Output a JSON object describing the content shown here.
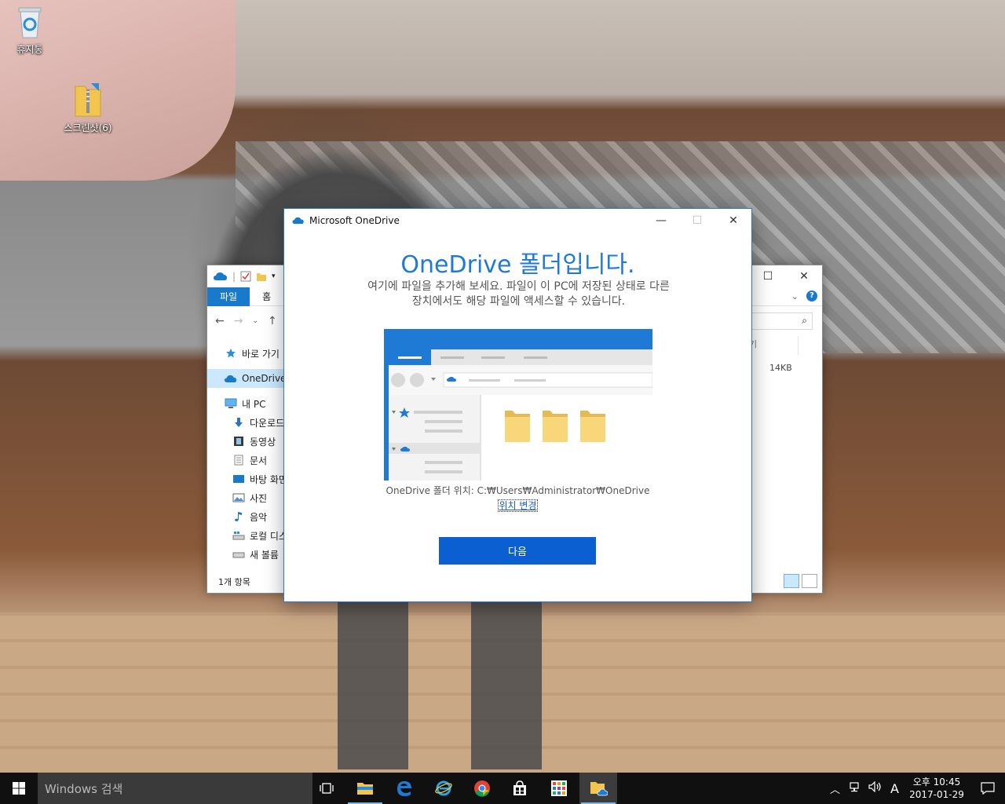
{
  "desktop": {
    "icons": [
      {
        "label": "휴지통"
      },
      {
        "label": "스크린샷(6)"
      }
    ]
  },
  "explorer": {
    "ribbon": {
      "file_tab": "파일",
      "home_tab": "홈"
    },
    "nav": {
      "quick_access": "바로 가기",
      "onedrive": "OneDrive",
      "this_pc": "내 PC",
      "downloads": "다운로드",
      "videos": "동영상",
      "documents": "문서",
      "desktop": "바탕 화면",
      "pictures": "사진",
      "music": "음악",
      "local_disk": "로컬 디스",
      "new_volume": "새 볼륨"
    },
    "column_header_fragment": "기",
    "file_size": "14KB",
    "status": "1개 항목"
  },
  "dialog": {
    "title": "Microsoft OneDrive",
    "heading": "OneDrive 폴더입니다.",
    "subtitle_line1": "여기에 파일을 추가해 보세요. 파일이 이 PC에 저장된 상태로 다른",
    "subtitle_line2": "장치에서도 해당 파일에 액세스할 수 있습니다.",
    "location_text": "OneDrive 폴더 위치: C:₩Users₩Administrator₩OneDrive",
    "change_location": "위치 변경",
    "next_button": "다음",
    "accent_color": "#1f7ad6"
  },
  "taskbar": {
    "search_placeholder": "Windows 검색",
    "apps": [
      "task-view",
      "file-explorer",
      "edge",
      "internet-explorer",
      "chrome",
      "store",
      "office",
      "onedrive"
    ],
    "input_indicator": "A",
    "time": "오후 10:45",
    "date": "2017-01-29"
  }
}
